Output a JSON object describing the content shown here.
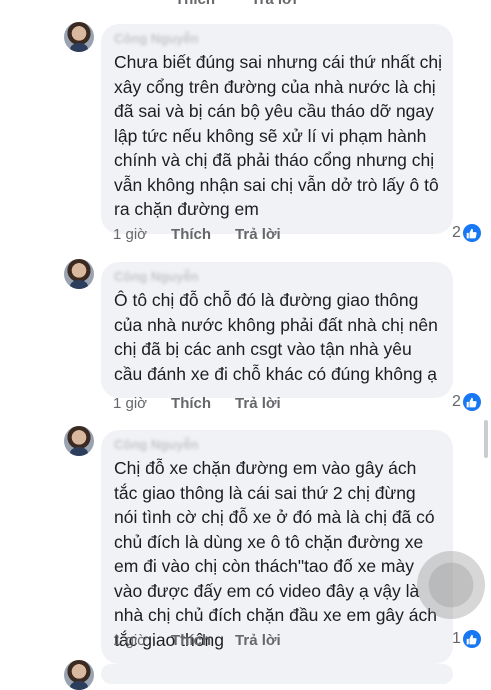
{
  "top_actions": {
    "like": "Thích",
    "reply": "Trả lời"
  },
  "comments": [
    {
      "author": "Công Nguyễn",
      "text": "Chưa biết đúng sai nhưng cái thứ nhất chị xây cổng trên đường của nhà nước là chị đã sai và bị cán bộ yêu cầu tháo dỡ ngay lập tức nếu không sẽ xử lí vi phạm hành chính và chị đã phải tháo cổng nhưng chị vẫn không nhận sai chị vẫn dở trò lấy ô tô ra chặn đường em",
      "time": "1 giờ",
      "like": "Thích",
      "reply": "Trả lời",
      "reaction_count": "2"
    },
    {
      "author": "Công Nguyễn",
      "text": "Ô tô chị đỗ chỗ đó là đường giao thông của nhà nước không phải đất nhà chị nên chị đã bị các anh csgt vào tận nhà yêu cầu đánh xe đi chỗ khác có đúng không ạ",
      "time": "1 giờ",
      "like": "Thích",
      "reply": "Trả lời",
      "reaction_count": "2"
    },
    {
      "author": "Công Nguyễn",
      "text": "Chị đỗ xe chặn đường em vào gây ách tắc giao thông là cái sai thứ 2 chị đừng nói tình cờ chị đỗ xe ở đó mà là chị đã có chủ đích là dùng xe ô tô chặn đường xe em đi vào chị còn thách\"tao đố xe mày vào được đấy em có video đây ạ vậy là nhà chị chủ đích chặn đầu xe em gây ách tắc giao thông",
      "time": "1 giờ",
      "like": "Thích",
      "reply": "Trả lời",
      "reaction_count": "1"
    }
  ],
  "colors": {
    "like_blue": "#1877f2",
    "bubble": "#f0f2f5",
    "meta": "#65676b"
  },
  "icons": {
    "reaction": "like-thumb-icon",
    "avatar": "user-avatar"
  }
}
